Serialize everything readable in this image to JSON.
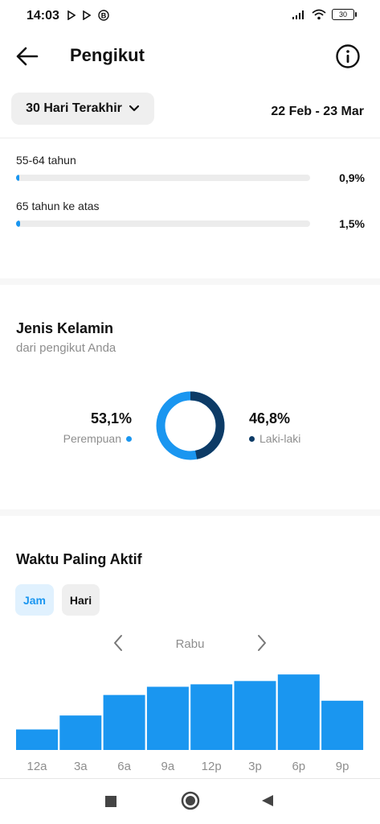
{
  "status": {
    "time": "14:03",
    "battery": "30"
  },
  "header": {
    "title": "Pengikut"
  },
  "range": {
    "label": "30 Hari Terakhir",
    "dates": "22 Feb - 23 Mar"
  },
  "age": [
    {
      "label": "55-64 tahun",
      "pct": "0,9%",
      "value": 0.9
    },
    {
      "label": "65 tahun ke atas",
      "pct": "1,5%",
      "value": 1.5
    }
  ],
  "gender": {
    "title": "Jenis Kelamin",
    "subtitle": "dari pengikut Anda",
    "female": {
      "pct": "53,1%",
      "label": "Perempuan",
      "value": 53.1,
      "color": "#1a96f0"
    },
    "male": {
      "pct": "46,8%",
      "label": "Laki-laki",
      "value": 46.8,
      "color": "#0d3b66"
    }
  },
  "active": {
    "title": "Waktu Paling Aktif",
    "tab_hours": "Jam",
    "tab_days": "Hari",
    "day": "Rabu"
  },
  "chart_data": {
    "type": "bar",
    "categories": [
      "12a",
      "3a",
      "6a",
      "9a",
      "12p",
      "3p",
      "6p",
      "9p"
    ],
    "values": [
      25,
      42,
      67,
      77,
      80,
      84,
      92,
      60
    ],
    "ylim": [
      0,
      100
    ],
    "color": "#1a96f0"
  }
}
